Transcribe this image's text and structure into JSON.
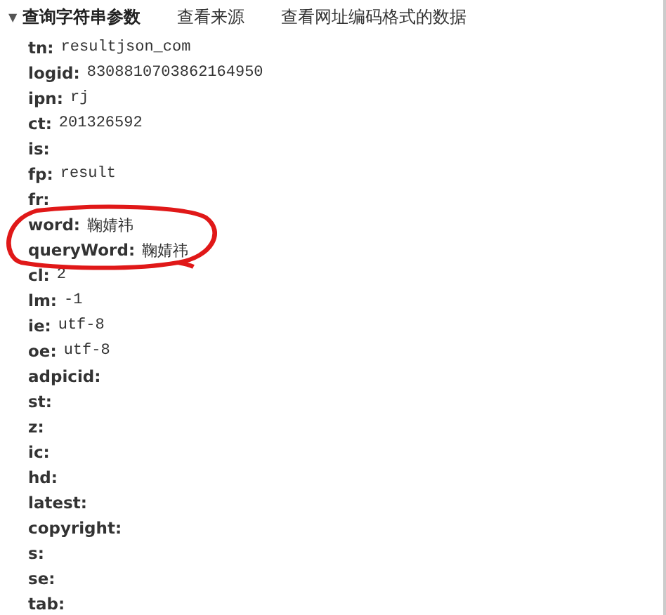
{
  "header": {
    "toggle": "▼",
    "title": "查询字符串参数",
    "links": [
      "查看来源",
      "查看网址编码格式的数据"
    ]
  },
  "params": [
    {
      "key": "tn:",
      "value": "resultjson_com",
      "circled": false
    },
    {
      "key": "logid:",
      "value": "8308810703862164950",
      "circled": false
    },
    {
      "key": "ipn:",
      "value": "rj",
      "circled": false
    },
    {
      "key": "ct:",
      "value": "201326592",
      "circled": false
    },
    {
      "key": "is:",
      "circled": false
    },
    {
      "key": "fp:",
      "value": "result",
      "circled": false
    },
    {
      "key": "fr:",
      "circled": false
    },
    {
      "key": "word:",
      "value": "鞠婧祎",
      "circled": true
    },
    {
      "key": "queryWord:",
      "value": "鞠婧祎",
      "circled": true
    },
    {
      "key": "cl:",
      "value": "2",
      "circled": false
    },
    {
      "key": "lm:",
      "value": "-1",
      "circled": false
    },
    {
      "key": "ie:",
      "value": "utf-8",
      "circled": false
    },
    {
      "key": "oe:",
      "value": "utf-8",
      "circled": false
    },
    {
      "key": "adpicid:",
      "circled": false
    },
    {
      "key": "st:",
      "circled": false
    },
    {
      "key": "z:",
      "circled": false
    },
    {
      "key": "ic:",
      "circled": false
    },
    {
      "key": "hd:",
      "circled": false
    },
    {
      "key": "latest:",
      "circled": false
    },
    {
      "key": "copyright:",
      "circled": false
    },
    {
      "key": "s:",
      "circled": false
    },
    {
      "key": "se:",
      "circled": false
    },
    {
      "key": "tab:",
      "circled": false
    }
  ]
}
